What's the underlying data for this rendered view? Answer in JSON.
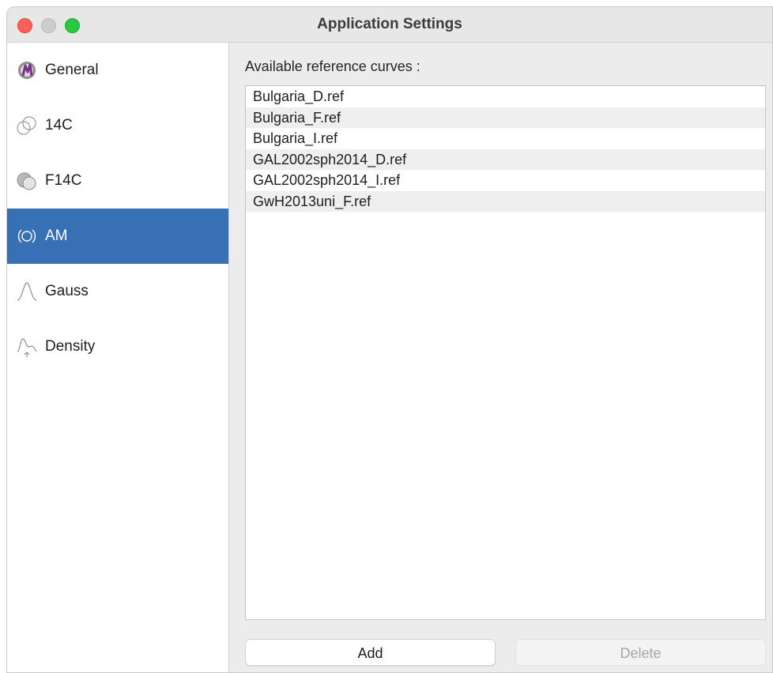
{
  "window": {
    "title": "Application Settings"
  },
  "sidebar": {
    "items": [
      {
        "label": "General",
        "icon": "chronomodel-logo-icon",
        "active": false
      },
      {
        "label": "14C",
        "icon": "overlapping-circles-icon",
        "active": false
      },
      {
        "label": "F14C",
        "icon": "shaded-circles-icon",
        "active": false
      },
      {
        "label": "AM",
        "icon": "magnet-ring-icon",
        "active": true
      },
      {
        "label": "Gauss",
        "icon": "bell-curve-icon",
        "active": false
      },
      {
        "label": "Density",
        "icon": "density-curve-icon",
        "active": false
      }
    ],
    "active_color": "#3770b4"
  },
  "main": {
    "list_label": "Available reference curves :",
    "curves": [
      "Bulgaria_D.ref",
      "Bulgaria_F.ref",
      "Bulgaria_I.ref",
      "GAL2002sph2014_D.ref",
      "GAL2002sph2014_I.ref",
      "GwH2013uni_F.ref"
    ],
    "add_label": "Add",
    "delete_label": "Delete"
  }
}
